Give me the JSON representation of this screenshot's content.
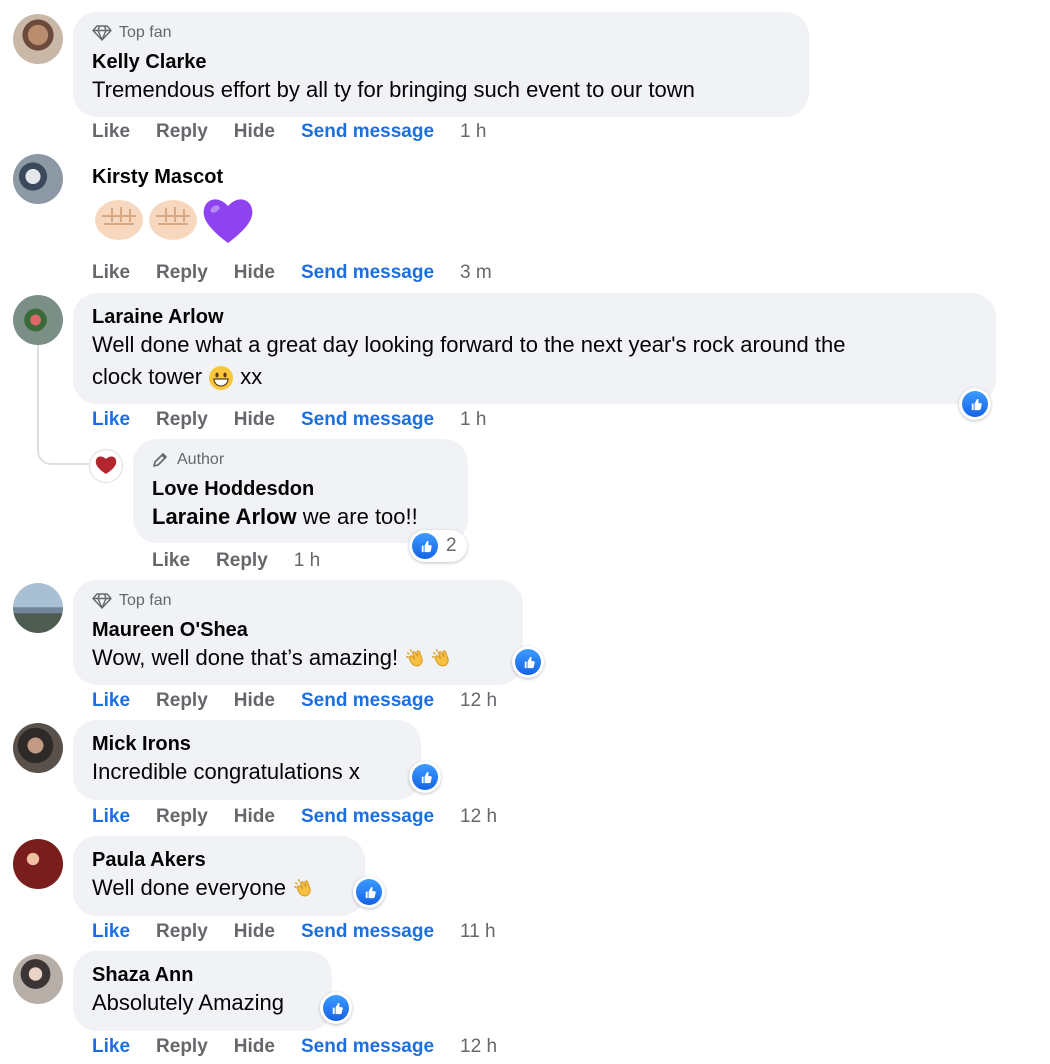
{
  "actions": {
    "like": "Like",
    "reply": "Reply",
    "hide": "Hide",
    "send_message": "Send message"
  },
  "comments": [
    {
      "badge": "Top fan",
      "name": "Kelly Clarke",
      "text": "Tremendous effort by all ty for bringing such event to our town",
      "time": "1 h"
    },
    {
      "name": "Kirsty Mascot",
      "text": "",
      "emojis": [
        "fist-emoji",
        "fist-emoji",
        "purple-heart-emoji"
      ],
      "time": "3 m"
    },
    {
      "name": "Laraine Arlow",
      "text_line1": "Well done what a great day looking forward to the next year's rock around the",
      "text_line2": "clock tower",
      "text_after_emoji": "xx",
      "time": "1 h",
      "liked": true
    },
    {
      "badge": "Author",
      "name": "Love Hoddesdon",
      "mention": "Laraine Arlow",
      "text": "we are too!!",
      "time": "1 h",
      "reaction_count": "2",
      "avatar_text": "Love",
      "avatar_subtext": "Hoddesdon"
    },
    {
      "badge": "Top fan",
      "name": "Maureen O'Shea",
      "text": "Wow, well done that’s amazing!",
      "time": "12 h",
      "liked": true
    },
    {
      "name": "Mick Irons",
      "text": "Incredible congratulations x",
      "time": "12 h",
      "liked": true
    },
    {
      "name": "Paula Akers",
      "text": "Well done everyone",
      "time": "11 h",
      "liked": true
    },
    {
      "name": "Shaza Ann",
      "text": "Absolutely Amazing",
      "time": "12 h",
      "liked": true
    }
  ],
  "colors": {
    "bubble": "#f0f2f5",
    "link": "#1c6fe0",
    "meta": "#65676b",
    "like": "#1877f2"
  }
}
